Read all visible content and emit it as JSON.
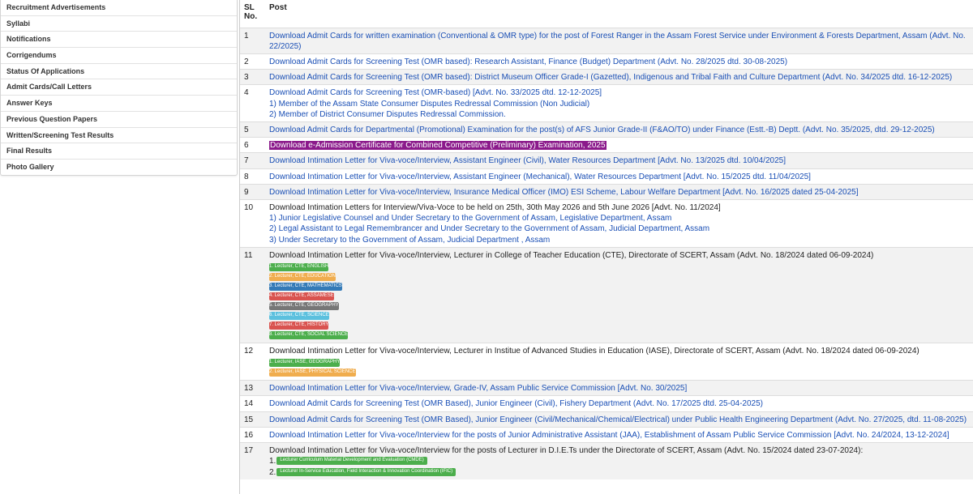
{
  "sidebar": {
    "items": [
      "Recruitment Advertisements",
      "Syllabi",
      "Notifications",
      "Corrigendums",
      "Status Of Applications",
      "Admit Cards/Call Letters",
      "Answer Keys",
      "Previous Question Papers",
      "Written/Screening Test Results",
      "Final Results",
      "Photo Gallery"
    ]
  },
  "table": {
    "headers": {
      "sl": "SL No.",
      "post": "Post"
    },
    "rows": [
      {
        "sl": "1",
        "title": "Download Admit Cards for written examination (Conventional & OMR type) for the post of Forest Ranger in the Assam Forest Service under Environment & Forests Department, Assam (Advt. No. 22/2025)"
      },
      {
        "sl": "2",
        "title": "Download Admit Cards for Screening Test (OMR based): Research Assistant, Finance (Budget) Department (Advt. No. 28/2025 dtd. 30-08-2025)"
      },
      {
        "sl": "3",
        "title": "Download Admit Cards for Screening Test (OMR based): District Museum Officer Grade-I (Gazetted), Indigenous and Tribal Faith and Culture Department (Advt. No. 34/2025 dtd. 16-12-2025)"
      },
      {
        "sl": "4",
        "title": "Download Admit Cards for Screening Test (OMR-based) [Advt. No. 33/2025 dtd. 12-12-2025]",
        "subs": [
          "1) Member of the Assam State Consumer Disputes Redressal Commission (Non Judicial)",
          "2) Member of District Consumer Disputes Redressal Commission."
        ]
      },
      {
        "sl": "5",
        "title": "Download Admit Cards for Departmental (Promotional) Examination for the post(s) of AFS Junior Grade-II (F&AO/TO) under Finance (Estt.-B) Deptt. (Advt. No. 35/2025, dtd. 29-12-2025)"
      },
      {
        "sl": "6",
        "title": "Download e-Admission Certificate for Combined Competitive (Preliminary) Examination, 2025",
        "highlight": true
      },
      {
        "sl": "7",
        "title": "Download Intimation Letter for Viva-voce/Interview, Assistant Engineer (Civil), Water Resources Department [Advt. No. 13/2025 dtd. 10/04/2025]"
      },
      {
        "sl": "8",
        "title": "Download Intimation Letter for Viva-voce/Interview, Assistant Engineer (Mechanical), Water Resources Department [Advt. No. 15/2025 dtd. 11/04/2025]"
      },
      {
        "sl": "9",
        "title": "Download Intimation Letter for Viva-voce/Interview, Insurance Medical Officer (IMO) ESI Scheme, Labour Welfare Department [Advt. No. 16/2025 dated 25-04-2025]"
      },
      {
        "sl": "10",
        "title": "Download Intimation Letters for Interview/Viva-Voce to be held on 25th, 30th May 2026 and 5th June 2026 [Advt. No. 11/2024]",
        "plain": true,
        "subs": [
          "1) Junior Legislative Counsel and Under Secretary to the Government of Assam, Legislative Department, Assam",
          "2) Legal Assistant to Legal Remembrancer and Under Secretary to the Government of Assam, Judicial Department, Assam",
          "3) Under Secretary to the Government of Assam, Judicial Department , Assam"
        ]
      },
      {
        "sl": "11",
        "title": "Download Intimation Letter for Viva-voce/Interview, Lecturer in College of Teacher Education (CTE), Directorate of SCERT, Assam (Advt. No. 18/2024 dated 06-09-2024)",
        "plain": true,
        "badges": [
          {
            "label": "1. Lecturer, CTE, ENGLISH",
            "color": "#4cae4c"
          },
          {
            "label": "2. Lecturer, CTE, EDUCATION",
            "color": "#f0ad4e"
          },
          {
            "label": "3. Lecturer, CTE, MATHEMATICS",
            "color": "#337ab7"
          },
          {
            "label": "4. Lecturer, CTE, ASSAMESE",
            "color": "#d9534f"
          },
          {
            "label": "5. Lecturer, CTE, GEOGRAPHY",
            "color": "#777777"
          },
          {
            "label": "6. Lecturer, CTE, SCIENCE",
            "color": "#5bc0de"
          },
          {
            "label": "7. Lecturer, CTE, HISTORY",
            "color": "#d9534f"
          },
          {
            "label": "8. Lecturer, CTE, SOCIAL SCIENCE",
            "color": "#4cae4c"
          }
        ]
      },
      {
        "sl": "12",
        "title": "Download Intimation Letter for Viva-voce/Interview, Lecturer in Institue of Advanced Studies in Education (IASE), Directorate of SCERT, Assam (Advt. No. 18/2024 dated 06-09-2024)",
        "plain": true,
        "badges": [
          {
            "label": "1. Lecturer, IASE, GEOGRAPHY",
            "color": "#4cae4c"
          },
          {
            "label": "2. Lecturer, IASE, PHYSICAL SCIENCE",
            "color": "#f0ad4e"
          }
        ]
      },
      {
        "sl": "13",
        "title": "Download Intimation Letter for Viva-voce/Interview, Grade-IV, Assam Public Service Commission [Advt. No. 30/2025]"
      },
      {
        "sl": "14",
        "title": "Download Admit Cards for Screening Test (OMR Based), Junior Engineer (Civil), Fishery Department (Advt. No. 17/2025 dtd. 25-04-2025)"
      },
      {
        "sl": "15",
        "title": "Download Admit Cards for Screening Test (OMR Based), Junior Engineer (Civil/Mechanical/Chemical/Electrical) under Public Health Engineering Department (Advt. No. 27/2025, dtd. 11-08-2025)"
      },
      {
        "sl": "16",
        "title": "Download Intimation Letter for Viva-voce/Interview for the posts of Junior Administrative Assistant (JAA), Establishment of Assam Public Service Commission [Advt. No. 24/2024, 13-12-2024]"
      },
      {
        "sl": "17",
        "title": "Download Intimation Letter for Viva-voce/Interview for the posts of Lecturer in D.I.E.Ts under the Directorate of SCERT, Assam (Advt. No. 15/2024 dated 23-07-2024):",
        "plain": true,
        "numbered_badges": [
          {
            "num": "1.",
            "label": "Lecturer Curriculum Material Development and Evaluation (CMDE)",
            "color": "#4cae4c"
          },
          {
            "num": "2.",
            "label": "Lecturer In-Service Education, Field Interaction & Innovation Coordination (IFIC)",
            "color": "#4cae4c"
          }
        ]
      }
    ]
  }
}
